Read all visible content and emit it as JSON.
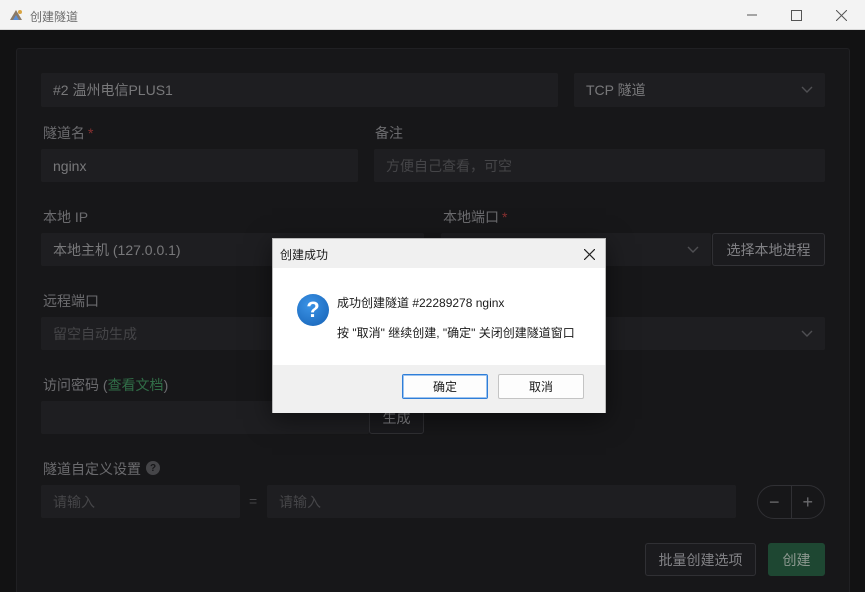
{
  "window": {
    "title": "创建隧道"
  },
  "form": {
    "node": "#2 温州电信PLUS1",
    "tunnel_type": "TCP 隧道",
    "name_label": "隧道名",
    "required_mark": "*",
    "name_value": "nginx",
    "note_label": "备注",
    "note_placeholder": "方便自己查看，可空",
    "local_ip_label": "本地 IP",
    "local_ip_value": "本地主机 (127.0.0.1)",
    "local_port_label": "本地端口",
    "select_process_button": "选择本地进程",
    "remote_port_label": "远程端口",
    "remote_port_placeholder": "留空自动生成",
    "password_label_prefix": "访问密码 (",
    "password_link": "查看文档",
    "password_label_suffix": ")",
    "generate_button": "生成",
    "custom_settings_label": "隧道自定义设置",
    "help_icon_text": "?",
    "custom_key_placeholder": "请输入",
    "equals": "=",
    "custom_value_placeholder": "请输入",
    "stepper_minus": "−",
    "stepper_plus": "+",
    "batch_button": "批量创建选项",
    "create_button": "创建"
  },
  "dialog": {
    "title": "创建成功",
    "icon_text": "?",
    "message1": "成功创建隧道 #22289278 nginx",
    "message2": "按 \"取消\" 继续创建, \"确定\" 关闭创建隧道窗口",
    "ok_button": "确定",
    "cancel_button": "取消"
  },
  "icons": {
    "dialog_icon": "question-icon",
    "window_buttons": [
      "minimize-icon",
      "maximize-icon",
      "close-icon"
    ]
  },
  "colors": {
    "accent_green": "#2f6e4e",
    "link_green": "#4aa86d",
    "required_red": "#d04a4a",
    "dialog_icon_blue": "#1561b5"
  }
}
